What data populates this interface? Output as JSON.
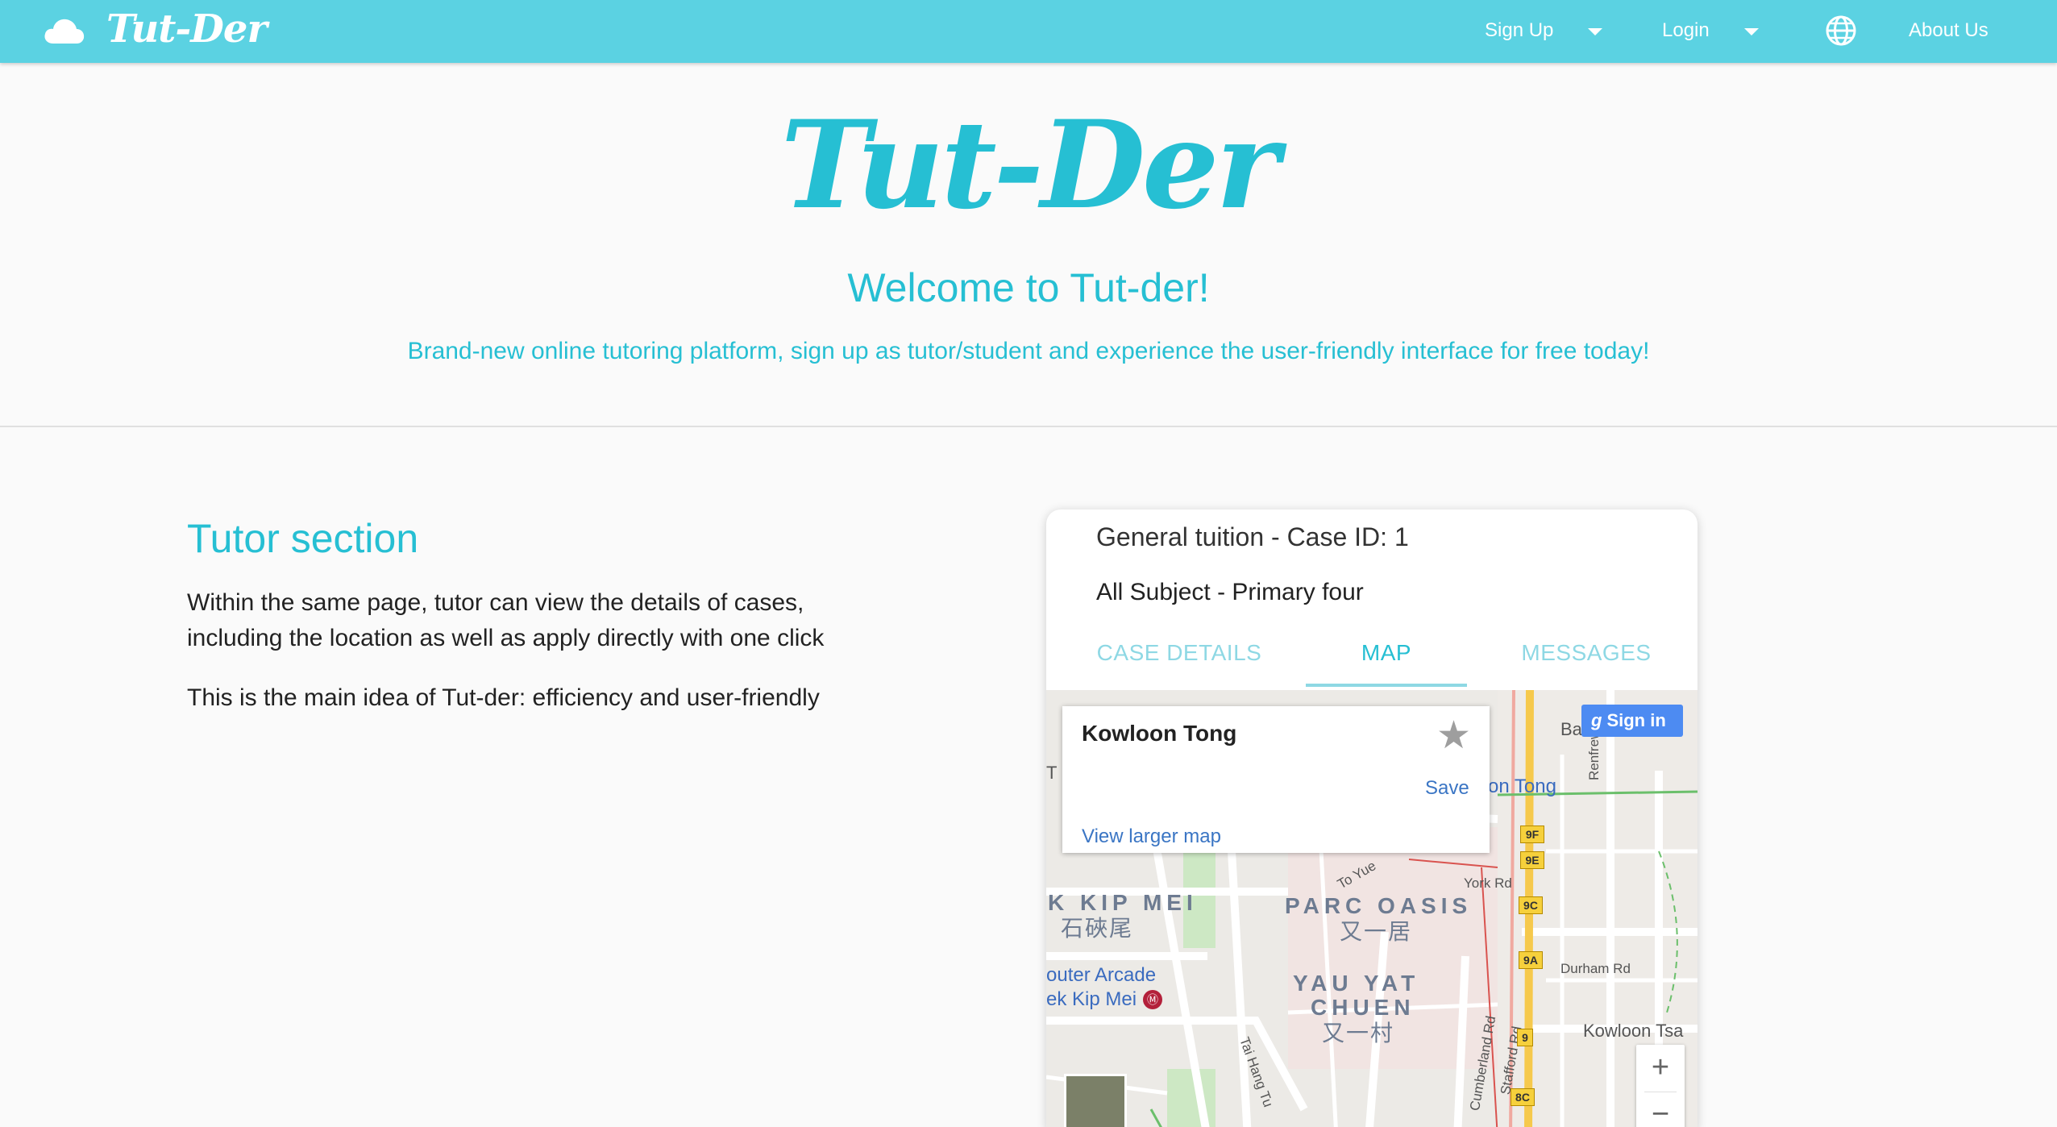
{
  "navbar": {
    "logo_text": "Tut-Der",
    "cloud_icon": "cloud-icon",
    "signup_label": "Sign Up",
    "login_label": "Login",
    "globe_icon": "globe-icon",
    "about_label": "About Us",
    "color": "#5bd2e2"
  },
  "hero": {
    "logo_text": "Tut-Der",
    "title": "Welcome to Tut-der!",
    "subtitle": "Brand-new online tutoring platform, sign up as tutor/student and experience the user-friendly interface for free today!",
    "accent_color": "#26bfd3"
  },
  "tutor_section": {
    "title": "Tutor section",
    "paragraph1": "Within the same page, tutor can view the details of cases, including the location as well as apply directly with one click",
    "paragraph2": "This is the main idea of Tut-der: efficiency and user-friendly"
  },
  "case_card": {
    "title": "General tuition - Case ID: 1",
    "subtitle": "All Subject - Primary four",
    "tabs": [
      {
        "label": "CASE DETAILS",
        "active": false
      },
      {
        "label": "MAP",
        "active": true
      },
      {
        "label": "MESSAGES",
        "active": false
      }
    ]
  },
  "map": {
    "info_window": {
      "place": "Kowloon Tong",
      "save_label": "Save",
      "larger_map_link": "View larger map"
    },
    "signin_label": "Sign in",
    "labels": {
      "kip_mei": "K KIP MEI",
      "kip_mei_cjk": "石硤尾",
      "parc_oasis": "PARC OASIS",
      "parc_oasis_cjk": "又一居",
      "yau_yat": "YAU YAT",
      "chuen": "CHUEN",
      "yau_yat_cjk": "又一村",
      "arcade": "outer Arcade",
      "kip_mei_station": "ek Kip Mei",
      "kowloon_tong_fragment": "on Tong",
      "kowloon_tsai": "Kowloon Tsa",
      "york_rd": "York Rd",
      "durham_rd": "Durham Rd",
      "renfrew_rd": "Renfrew Rd",
      "cumberland_rd": "Cumberland Rd",
      "stafford_rd": "Stafford Rd",
      "tai_hang_tung": "Tai Hang Tu",
      "to_yuen": "To Yue",
      "edge_t": "T",
      "edge_ba": "Ba"
    },
    "route_badges": [
      "9F",
      "9E",
      "9C",
      "9A",
      "9",
      "8C"
    ],
    "zoom_in": "+",
    "zoom_out": "−"
  }
}
